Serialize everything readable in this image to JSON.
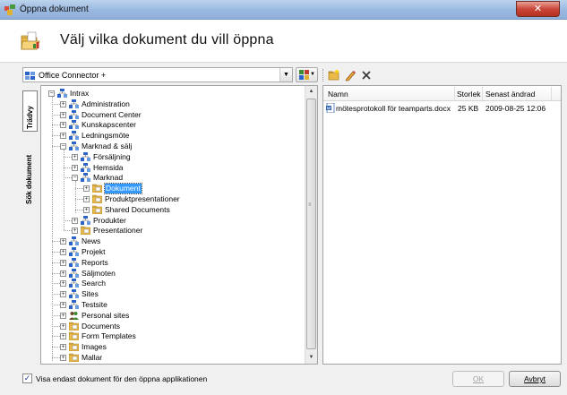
{
  "window": {
    "title": "Öppna dokument",
    "close_glyph": "✕"
  },
  "header": {
    "heading": "Välj vilka dokument du vill öppna",
    "icon": "open-folder-icon"
  },
  "source": {
    "selected": "Office Connector +"
  },
  "tabs": [
    {
      "label": "Trädvy",
      "active": true
    },
    {
      "label": "Sök dokument",
      "active": false
    }
  ],
  "tree": [
    {
      "label": "Intrax",
      "depth": 0,
      "expander": "−",
      "icon": "site"
    },
    {
      "label": "Administration",
      "depth": 1,
      "expander": "+",
      "icon": "site"
    },
    {
      "label": "Document Center",
      "depth": 1,
      "expander": "+",
      "icon": "site"
    },
    {
      "label": "Kunskapscenter",
      "depth": 1,
      "expander": "+",
      "icon": "site"
    },
    {
      "label": "Ledningsmöte",
      "depth": 1,
      "expander": "+",
      "icon": "site"
    },
    {
      "label": "Marknad & sälj",
      "depth": 1,
      "expander": "−",
      "icon": "site"
    },
    {
      "label": "Försäljning",
      "depth": 2,
      "expander": "+",
      "icon": "site"
    },
    {
      "label": "Hemsida",
      "depth": 2,
      "expander": "+",
      "icon": "site"
    },
    {
      "label": "Marknad",
      "depth": 2,
      "expander": "−",
      "icon": "site"
    },
    {
      "label": "Dokument",
      "depth": 3,
      "expander": "+",
      "icon": "library",
      "selected": true
    },
    {
      "label": "Produktpresentationer",
      "depth": 3,
      "expander": "+",
      "icon": "library"
    },
    {
      "label": "Shared Documents",
      "depth": 3,
      "expander": "+",
      "icon": "library"
    },
    {
      "label": "Produkter",
      "depth": 2,
      "expander": "+",
      "icon": "site"
    },
    {
      "label": "Presentationer",
      "depth": 2,
      "expander": "+",
      "icon": "library"
    },
    {
      "label": "News",
      "depth": 1,
      "expander": "+",
      "icon": "site"
    },
    {
      "label": "Projekt",
      "depth": 1,
      "expander": "+",
      "icon": "site"
    },
    {
      "label": "Reports",
      "depth": 1,
      "expander": "+",
      "icon": "site"
    },
    {
      "label": "Säljmoten",
      "depth": 1,
      "expander": "+",
      "icon": "site"
    },
    {
      "label": "Search",
      "depth": 1,
      "expander": "+",
      "icon": "site"
    },
    {
      "label": "Sites",
      "depth": 1,
      "expander": "+",
      "icon": "site"
    },
    {
      "label": "Testsite",
      "depth": 1,
      "expander": "+",
      "icon": "site"
    },
    {
      "label": "Personal sites",
      "depth": 1,
      "expander": "+",
      "icon": "people"
    },
    {
      "label": "Documents",
      "depth": 1,
      "expander": "+",
      "icon": "library"
    },
    {
      "label": "Form Templates",
      "depth": 1,
      "expander": "+",
      "icon": "library"
    },
    {
      "label": "Images",
      "depth": 1,
      "expander": "+",
      "icon": "library"
    },
    {
      "label": "Mallar",
      "depth": 1,
      "expander": "+",
      "icon": "library"
    }
  ],
  "list": {
    "columns": [
      "Namn",
      "Storlek",
      "Senast ändrad"
    ],
    "rows": [
      {
        "name": "mötesprotokoll för teamparts.docx",
        "size": "25 KB",
        "modified": "2009-08-25 12:06",
        "icon": "word-doc-icon"
      }
    ]
  },
  "footer": {
    "checkbox_label": "Visa endast dokument för den öppna applikationen",
    "checked": true,
    "ok_label": "OK",
    "cancel_label": "Avbryt"
  },
  "colors": {
    "selection": "#3399ff",
    "folder": "#e9b94a",
    "site_blue": "#2a64c8"
  }
}
